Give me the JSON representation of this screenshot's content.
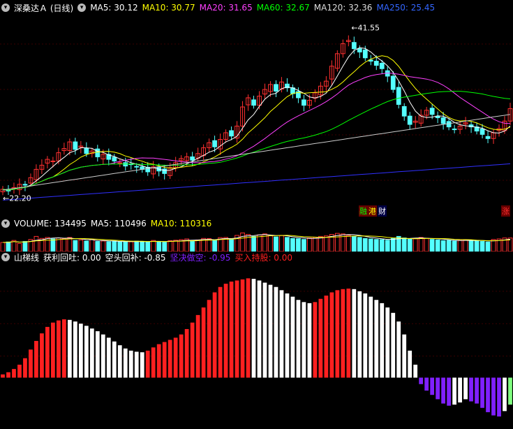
{
  "header_main": {
    "title": "深桑达Ａ (日线)",
    "ma5": "MA5: 30.12",
    "ma10": "MA10: 30.77",
    "ma20": "MA20: 31.65",
    "ma60": "MA60: 32.67",
    "ma120": "MA120: 32.36",
    "ma250": "MA250: 25.45"
  },
  "annotations": {
    "high": "41.55",
    "low": "22.20",
    "badge_a": "融",
    "badge_b": "港",
    "badge_c": "财",
    "badge_d": "涨"
  },
  "header_volume": {
    "title": "VOLUME: 134495",
    "ma5": "MA5: 110496",
    "ma10": "MA10: 110316"
  },
  "header_indicator": {
    "title": "山梯线",
    "profit": "获利回吐: 0.00",
    "short_cover": "空头回补: -0.85",
    "short": "坚决做空: -0.95",
    "hold": "买入持股: 0.00"
  },
  "colors": {
    "up": "#ff3030",
    "down": "#54ffff",
    "ma5": "#ffffff",
    "ma10": "#ffff00",
    "ma20": "#ff40ff",
    "ma60": "#00ff00",
    "ma120": "#cccccc",
    "ma250": "#3030ff",
    "red": "#ff2020",
    "white": "#ffffff",
    "purple": "#8020ff"
  },
  "chart_data": {
    "type": "candlestick",
    "high": 41.55,
    "low": 22.2,
    "closes": [
      22.6,
      22.4,
      22.8,
      23.2,
      23.1,
      24.0,
      25.0,
      25.5,
      26.2,
      26.0,
      27.0,
      27.5,
      28.3,
      27.4,
      27.8,
      26.9,
      27.2,
      26.5,
      26.8,
      26.2,
      26.0,
      25.8,
      25.4,
      25.6,
      25.3,
      25.0,
      24.7,
      25.3,
      24.8,
      24.5,
      25.2,
      25.8,
      26.3,
      26.5,
      26.1,
      26.9,
      27.6,
      28.2,
      27.7,
      28.6,
      29.4,
      29.0,
      30.2,
      32.5,
      33.6,
      32.7,
      33.8,
      34.6,
      35.2,
      34.4,
      35.5,
      34.8,
      34.1,
      33.6,
      32.7,
      33.3,
      34.2,
      35.0,
      35.6,
      37.4,
      38.9,
      40.1,
      40.5,
      39.5,
      39.1,
      38.4,
      38.0,
      37.5,
      37.1,
      36.2,
      34.6,
      32.8,
      31.4,
      30.4,
      30.8,
      31.5,
      32.1,
      31.6,
      31.2,
      30.5,
      30.1,
      29.8,
      30.2,
      30.6,
      30.1,
      29.6,
      29.2,
      28.7,
      29.4,
      29.9,
      30.8,
      32.3
    ],
    "volume": [
      90000,
      95000,
      110000,
      80000,
      100000,
      120000,
      150000,
      130000,
      140000,
      125000,
      135000,
      128000,
      140000,
      110000,
      115000,
      105000,
      120000,
      100000,
      105000,
      98000,
      102000,
      95000,
      100000,
      97000,
      103000,
      99000,
      96000,
      110000,
      100000,
      92000,
      108000,
      112000,
      118000,
      125000,
      104000,
      115000,
      130000,
      128000,
      110000,
      138000,
      140000,
      125000,
      160000,
      185000,
      170000,
      150000,
      165000,
      175000,
      160000,
      145000,
      158000,
      140000,
      130000,
      128000,
      120000,
      135000,
      140000,
      150000,
      155000,
      170000,
      180000,
      175000,
      160000,
      150000,
      140000,
      130000,
      125000,
      120000,
      118000,
      112000,
      130000,
      150000,
      135000,
      125000,
      128000,
      140000,
      132000,
      120000,
      115000,
      108000,
      110000,
      104000,
      112000,
      118000,
      110000,
      105000,
      100000,
      95000,
      120000,
      125000,
      134495,
      134495
    ],
    "indicator": [
      0.3,
      0.5,
      0.8,
      1.2,
      1.8,
      2.6,
      3.4,
      4.1,
      4.7,
      5.1,
      5.3,
      5.4,
      5.35,
      5.2,
      5.0,
      4.8,
      4.55,
      4.3,
      4.0,
      3.7,
      3.35,
      3.0,
      2.7,
      2.5,
      2.4,
      2.35,
      2.5,
      2.8,
      3.1,
      3.3,
      3.5,
      3.7,
      4.0,
      4.5,
      5.1,
      5.8,
      6.5,
      7.2,
      7.9,
      8.4,
      8.7,
      8.9,
      9.0,
      9.1,
      9.2,
      9.15,
      9.0,
      8.8,
      8.6,
      8.4,
      8.1,
      7.8,
      7.5,
      7.2,
      7.0,
      6.9,
      7.0,
      7.3,
      7.6,
      7.9,
      8.1,
      8.2,
      8.25,
      8.2,
      8.0,
      7.8,
      7.5,
      7.2,
      6.9,
      6.5,
      6.0,
      5.2,
      4.0,
      2.5,
      1.2,
      -0.6,
      -1.2,
      -1.6,
      -2.0,
      -2.4,
      -2.6,
      -2.5,
      -2.3,
      -2.0,
      -2.2,
      -2.4,
      -2.8,
      -3.2,
      -3.5,
      -3.6,
      -3.1,
      -2.5
    ]
  }
}
